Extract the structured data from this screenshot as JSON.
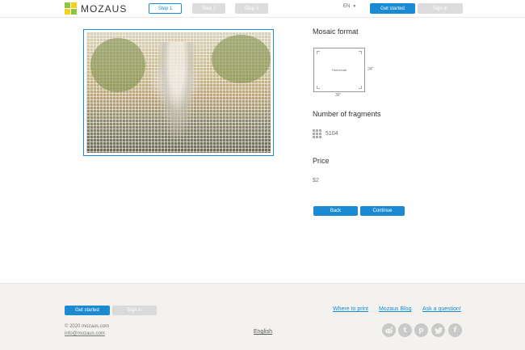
{
  "header": {
    "logo_text": "MOZAUS",
    "steps": [
      {
        "label": "Step 1"
      },
      {
        "label": "Step 2"
      },
      {
        "label": "Step 3"
      }
    ],
    "language": "EN",
    "get_started_label": "Get started",
    "sign_in_label": "Sign in"
  },
  "main": {
    "format_title": "Mosaic format",
    "format_label": "Horizontal",
    "format_height": "24\"",
    "format_width": "36\"",
    "fragments_title": "Number of fragments",
    "fragments_value": "5104",
    "price_title": "Price",
    "price_value": "$2",
    "back_label": "Back",
    "continue_label": "Continue"
  },
  "footer": {
    "get_started_label": "Get started",
    "sign_in_label": "Sign in",
    "links": [
      "Where to print",
      "Mozaus Blog",
      "Ask a question!"
    ],
    "copyright": "© 2020 mozaus.com",
    "email": "info@mozaus.com",
    "language": "English",
    "social_icons": [
      "reddit-icon",
      "tumblr-icon",
      "pinterest-icon",
      "twitter-icon",
      "facebook-icon"
    ]
  },
  "colors": {
    "accent": "#1a8bd3",
    "disabled": "#dcdcdc",
    "footer_bg": "#f4f2ef",
    "logo_green": "#8cc63f",
    "logo_yellow": "#f7d117"
  }
}
